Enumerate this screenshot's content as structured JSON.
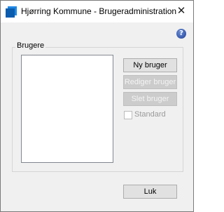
{
  "window": {
    "title": "Hjørring Kommune - Brugeradministration",
    "close_symbol": "✕",
    "app_icon": "blue-window-icon"
  },
  "help": {
    "icon": "help-question-icon",
    "symbol": "?"
  },
  "users_group": {
    "label": "Brugere",
    "list_items": []
  },
  "buttons": {
    "new_user": "Ny bruger",
    "edit_user": "Rediger bruger",
    "delete_user": "Slet bruger",
    "close": "Luk"
  },
  "standard_checkbox": {
    "label": "Standard",
    "checked": false,
    "enabled": false
  },
  "colors": {
    "accent": "#1e88e5",
    "window_bg": "#f0f0f0"
  }
}
